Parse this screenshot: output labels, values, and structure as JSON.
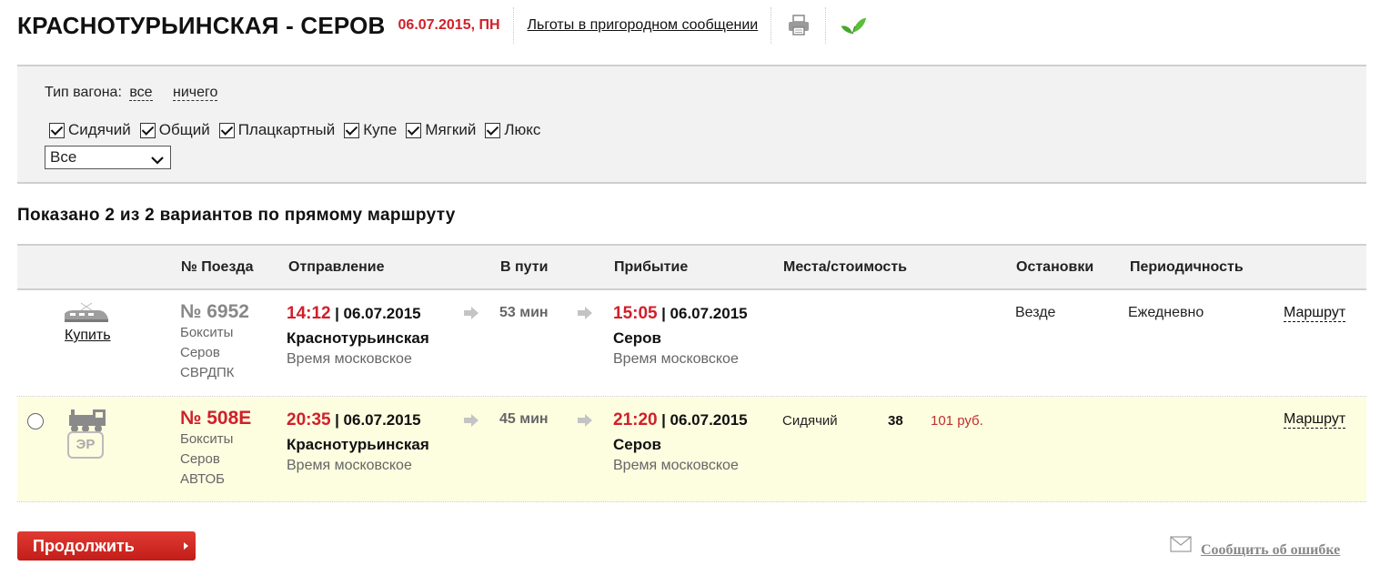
{
  "header": {
    "route": "КРАСНОТУРЬИНСКАЯ - СЕРОВ",
    "date": "06.07.2015, ПН",
    "benefits_link": "Льготы в пригородном сообщении"
  },
  "filter": {
    "car_type_label": "Тип вагона:",
    "all_link": "все",
    "none_link": "ничего",
    "checkboxes": [
      {
        "label": "Сидячий",
        "checked": true
      },
      {
        "label": "Общий",
        "checked": true
      },
      {
        "label": "Плацкартный",
        "checked": true
      },
      {
        "label": "Купе",
        "checked": true
      },
      {
        "label": "Мягкий",
        "checked": true
      },
      {
        "label": "Люкс",
        "checked": true
      }
    ],
    "select_value": "Все"
  },
  "results_title": "Показано 2 из 2 вариантов по прямому маршруту",
  "table": {
    "headers": {
      "train": "№ Поезда",
      "departure": "Отправление",
      "duration": "В пути",
      "arrival": "Прибытие",
      "seats": "Места/стоимость",
      "stops": "Остановки",
      "periodicity": "Периодичность"
    },
    "rows": [
      {
        "buy": "Купить",
        "number": "№ 6952",
        "from": "Бокситы",
        "to": "Серов",
        "carrier": "СВРДПК",
        "dep_time": "14:12",
        "dep_date": "| 06.07.2015",
        "dep_station": "Краснотурьинская",
        "dep_tz": "Время московское",
        "duration": "53 мин",
        "arr_time": "15:05",
        "arr_date": "| 06.07.2015",
        "arr_station": "Серов",
        "arr_tz": "Время московское",
        "stops": "Везде",
        "periodicity": "Ежедневно",
        "route_link": "Маршрут"
      },
      {
        "icon_label": "ЭР",
        "number": "№ 508Е",
        "from": "Бокситы",
        "to": "Серов",
        "carrier": "АВТОБ",
        "dep_time": "20:35",
        "dep_date": "| 06.07.2015",
        "dep_station": "Краснотурьинская",
        "dep_tz": "Время московское",
        "duration": "45 мин",
        "arr_time": "21:20",
        "arr_date": "| 06.07.2015",
        "arr_station": "Серов",
        "arr_tz": "Время московское",
        "seat_type": "Сидячий",
        "seat_count": "38",
        "price": "101 руб.",
        "route_link": "Маршрут"
      }
    ]
  },
  "footer": {
    "continue": "Продолжить",
    "report": "Сообщить об ошибке"
  },
  "icons": [
    "printer-icon",
    "leaf-icon",
    "express-train-icon",
    "locomotive-icon",
    "envelope-icon",
    "chevron-down-icon",
    "arrow-right-icon"
  ],
  "colors": {
    "accent_red": "#d0202a",
    "highlight_row": "#fdfde0",
    "panel_gray": "#f2f2f2"
  }
}
